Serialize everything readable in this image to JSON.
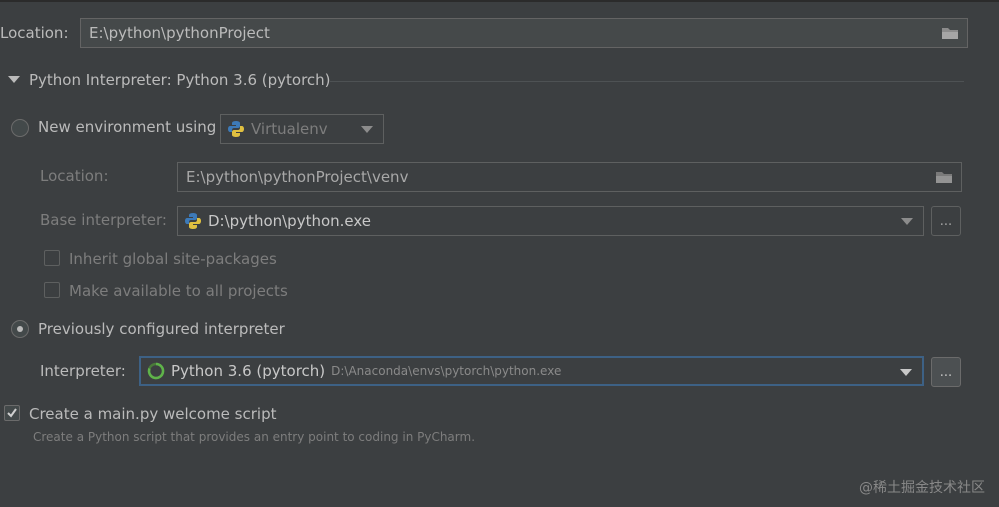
{
  "project": {
    "location_label": "Location:",
    "location_value": "E:\\python\\pythonProject"
  },
  "interpreter_section": {
    "title": "Python Interpreter: Python 3.6 (pytorch)"
  },
  "new_env": {
    "radio_label": "New environment using",
    "tool_value": "Virtualenv",
    "location_label": "Location:",
    "location_value": "E:\\python\\pythonProject\\venv",
    "base_label": "Base interpreter:",
    "base_value": "D:\\python\\python.exe",
    "browse_label": "...",
    "inherit_label": "Inherit global site-packages",
    "make_available_label": "Make available to all projects"
  },
  "previous": {
    "radio_label": "Previously configured interpreter",
    "interpreter_label": "Interpreter:",
    "interpreter_name": "Python 3.6 (pytorch)",
    "interpreter_path": "D:\\Anaconda\\envs\\pytorch\\python.exe",
    "browse_label": "..."
  },
  "welcome": {
    "checkbox_label": "Create a main.py welcome script",
    "hint": "Create a Python script that provides an entry point to coding in PyCharm."
  },
  "watermark": "@稀土掘金技术社区",
  "colors": {
    "background": "#3c3f41",
    "text": "#bbbbbb",
    "focus_border": "#3d6185"
  }
}
